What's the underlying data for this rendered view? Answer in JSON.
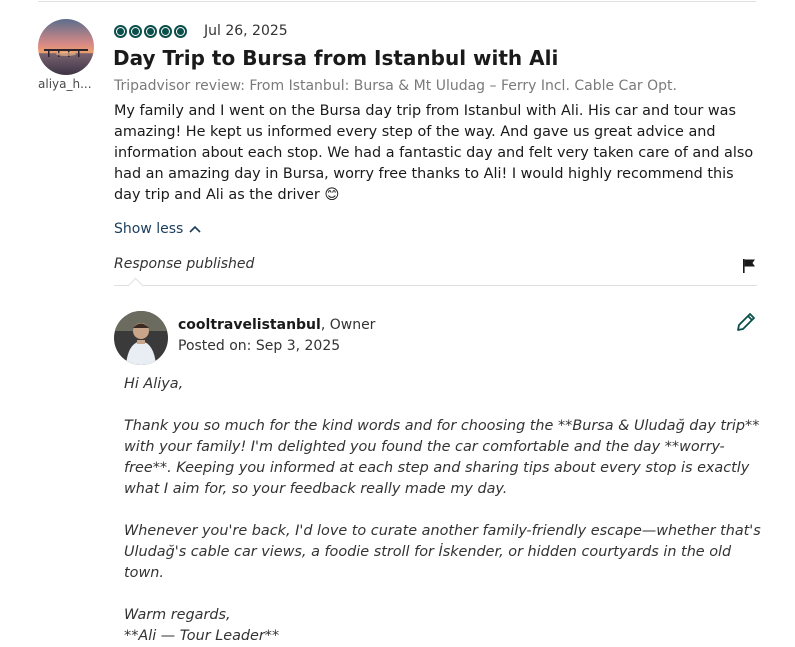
{
  "review": {
    "username": "aliya_h...",
    "rating": 5,
    "date": "Jul 26, 2025",
    "title": "Day Trip to Bursa from Istanbul with Ali",
    "subtitle": "Tripadvisor review: From Istanbul: Bursa & Mt Uludag – Ferry Incl. Cable Car Opt.",
    "body": "My family and I went on the Bursa day trip from Istanbul with Ali. His car and tour was amazing! He kept us informed every step of the way. And gave us great advice and information about each stop. We had a fantastic day and felt very taken care of and also had an amazing day in Bursa, worry free thanks to Ali! I would highly recommend this day trip and Ali as the driver",
    "emoji": "😊",
    "show_less_label": "Show less",
    "response_status": "Response published"
  },
  "response": {
    "owner_name": "cooltravelistanbul",
    "owner_role": ", Owner",
    "posted_label": "Posted on:",
    "posted_date": "Sep 3, 2025",
    "greeting": "Hi Aliya,",
    "paragraph1": "Thank you so much for the kind words and for choosing the **Bursa & Uludağ day trip** with your family! I'm delighted you found the car comfortable and the day **worry-free**. Keeping you informed at each step and sharing tips about every stop is exactly what I aim for, so your feedback really made my day.",
    "paragraph2": "Whenever you're back, I'd love to curate another family-friendly escape—whether that's Uludağ's cable car views, a foodie stroll for İskender, or hidden courtyards in the old town.",
    "signoff": "Warm regards,",
    "signature": "**Ali — Tour Leader**"
  },
  "colors": {
    "rating_bubble": "#0b4f4a",
    "link": "#1a3d5c"
  }
}
